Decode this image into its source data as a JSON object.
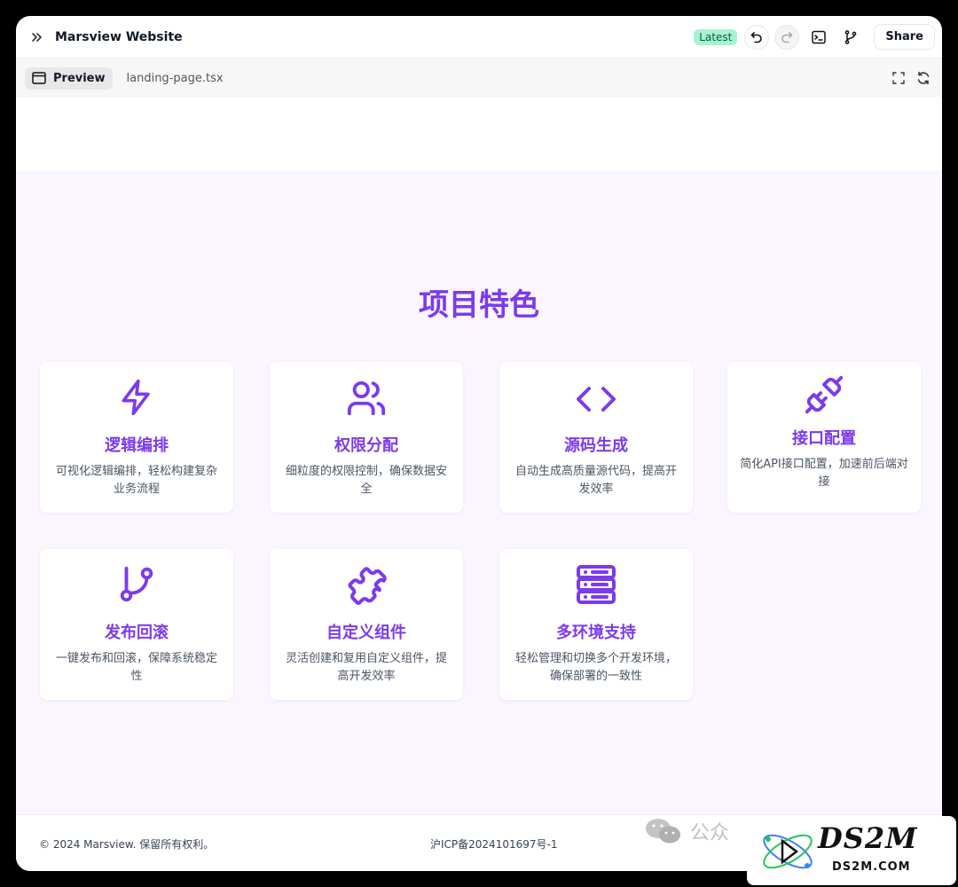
{
  "window": {
    "title": "Marsview Website",
    "badge": "Latest",
    "share_label": "Share"
  },
  "tabs": {
    "preview_label": "Preview",
    "file_label": "landing-page.tsx"
  },
  "features": {
    "heading": "项目特色",
    "accent_color": "#7c3aed",
    "items": [
      {
        "icon": "lightning-icon",
        "title": "逻辑编排",
        "desc": "可视化逻辑编排，轻松构建复杂业务流程"
      },
      {
        "icon": "users-icon",
        "title": "权限分配",
        "desc": "细粒度的权限控制，确保数据安全"
      },
      {
        "icon": "code-icon",
        "title": "源码生成",
        "desc": "自动生成高质量源代码，提高开发效率"
      },
      {
        "icon": "plug-icon",
        "title": "接口配置",
        "desc": "简化API接口配置，加速前后端对接"
      },
      {
        "icon": "git-branch-icon",
        "title": "发布回滚",
        "desc": "一键发布和回滚，保障系统稳定性"
      },
      {
        "icon": "puzzle-icon",
        "title": "自定义组件",
        "desc": "灵活创建和复用自定义组件，提高开发效率"
      },
      {
        "icon": "server-icon",
        "title": "多环境支持",
        "desc": "轻松管理和切换多个开发环境，确保部署的一致性"
      }
    ]
  },
  "footer": {
    "copyright": "© 2024 Marsview. 保留所有权利。",
    "icp": "沪ICP备2024101697号-1"
  },
  "watermark": {
    "text": "公众",
    "logo_text": "DS2M",
    "logo_url_text": "DS2M.COM"
  }
}
